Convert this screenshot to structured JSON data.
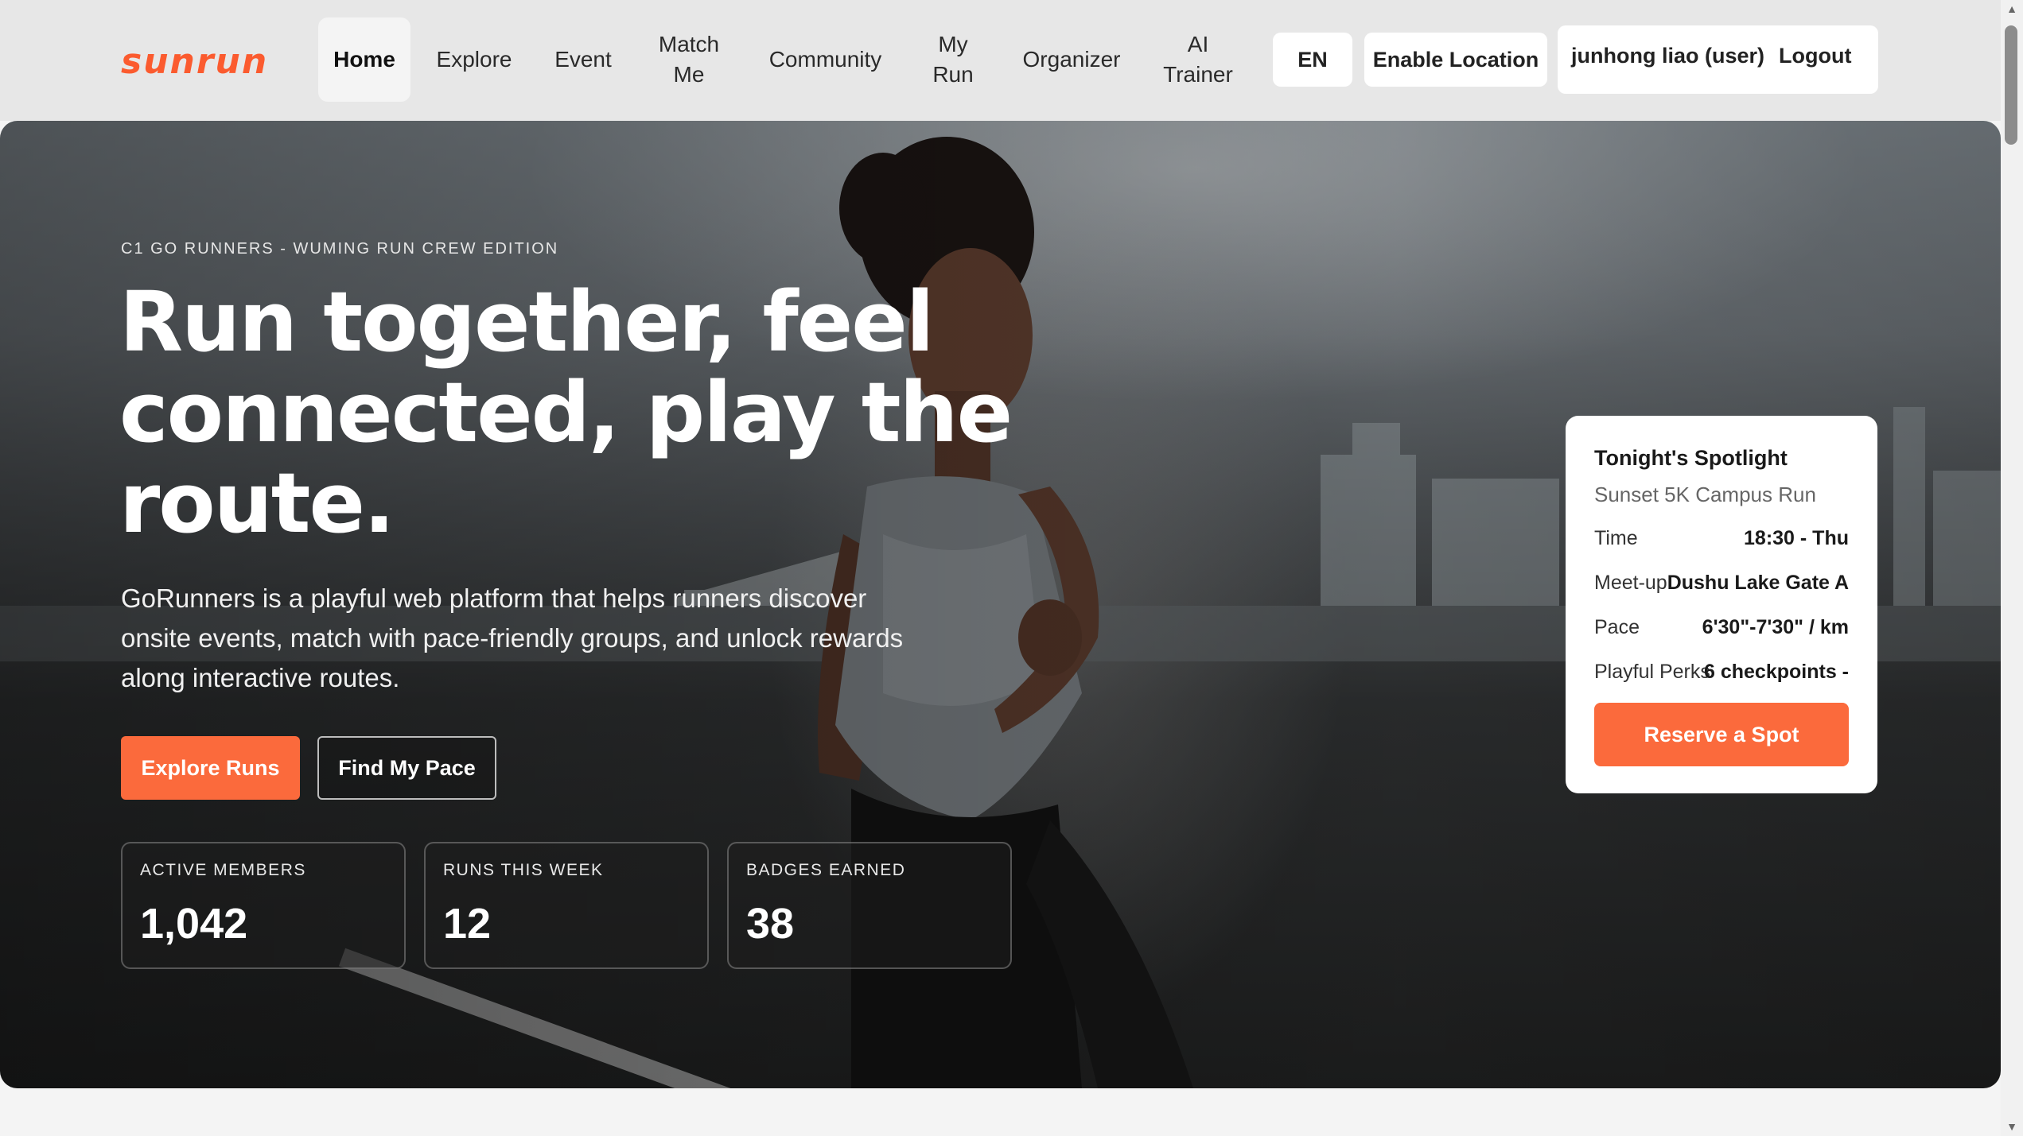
{
  "nav": {
    "logo": "sunrun",
    "items": [
      {
        "label": "Home"
      },
      {
        "label": "Explore"
      },
      {
        "label": "Event"
      },
      {
        "label": "Match Me"
      },
      {
        "label": "Community"
      },
      {
        "label": "My Run"
      },
      {
        "label": "Organizer"
      },
      {
        "label": "AI Trainer"
      }
    ],
    "language": "EN",
    "location_button": "Enable Location",
    "user": "junhong liao (user)",
    "logout": "Logout"
  },
  "hero": {
    "eyebrow": "C1 GO RUNNERS - WUMING RUN CREW EDITION",
    "headline": "Run together, feel connected, play the route.",
    "subtext": "GoRunners is a playful web platform that helps runners discover onsite events, match with pace-friendly groups, and unlock rewards along interactive routes.",
    "primary_cta": "Explore Runs",
    "secondary_cta": "Find My Pace",
    "stats": [
      {
        "label": "ACTIVE MEMBERS",
        "value": "1,042"
      },
      {
        "label": "RUNS THIS WEEK",
        "value": "12"
      },
      {
        "label": "BADGES EARNED",
        "value": "38"
      }
    ]
  },
  "spotlight": {
    "title": "Tonight's Spotlight",
    "event": "Sunset 5K Campus Run",
    "rows": [
      {
        "label": "Time",
        "value": "18:30 - Thu"
      },
      {
        "label": "Meet-up",
        "value": "Dushu Lake Gate A"
      },
      {
        "label": "Pace",
        "value": "6'30\"-7'30\" / km"
      },
      {
        "label": "Playful Perks",
        "value": "6 checkpoints -"
      }
    ],
    "cta": "Reserve a Spot"
  },
  "colors": {
    "accent": "#fb6a3c",
    "logo": "#fb5b2f",
    "nav_bg": "#e7e7e7"
  }
}
